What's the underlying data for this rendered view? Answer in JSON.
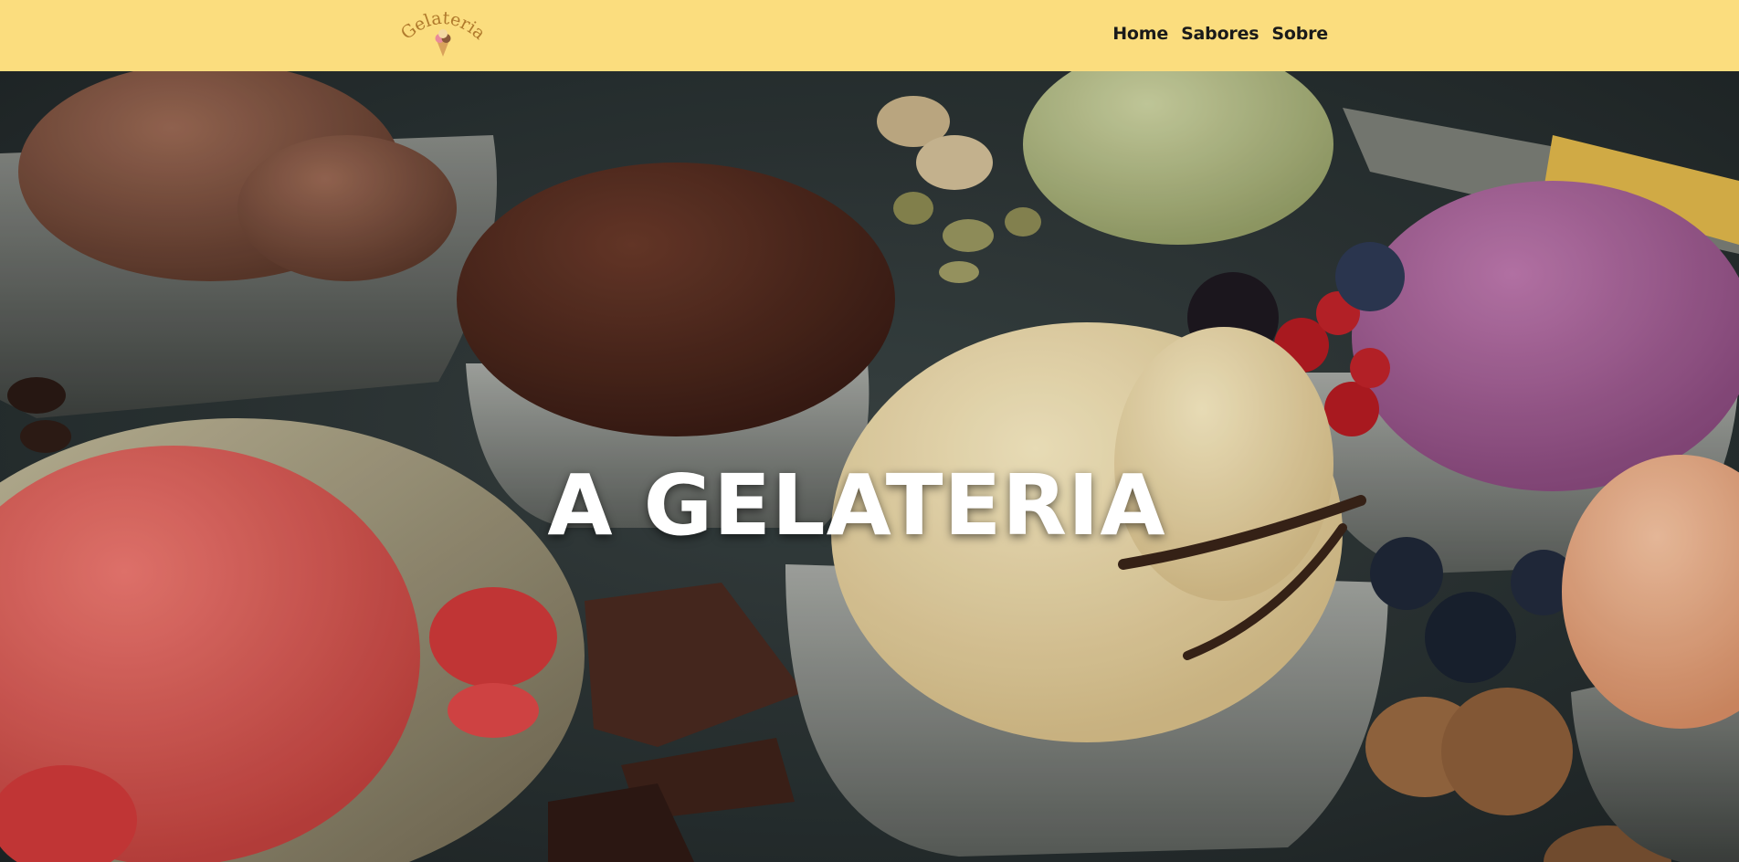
{
  "brand": {
    "logo_text": "Gelateria",
    "logo_color": "#b07a2c",
    "navbar_color": "#fbdd7e"
  },
  "nav": {
    "items": [
      {
        "label": "Home"
      },
      {
        "label": "Sabores"
      },
      {
        "label": "Sobre"
      }
    ]
  },
  "hero": {
    "title": "A GELATERIA"
  }
}
